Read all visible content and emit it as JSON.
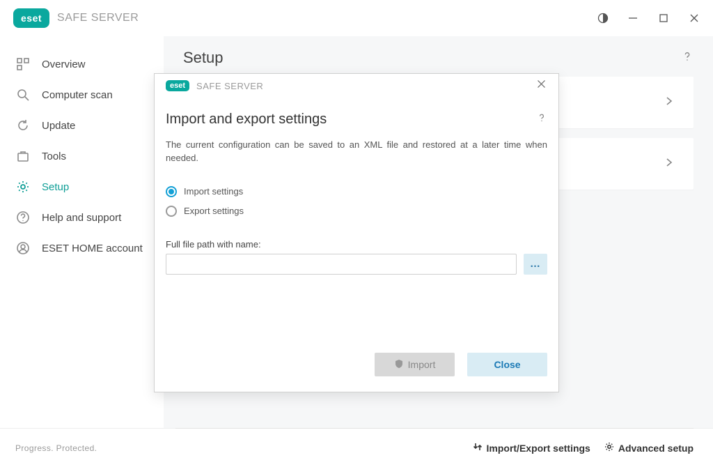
{
  "titlebar": {
    "logo_text": "eset",
    "product_name": "SAFE SERVER"
  },
  "sidebar": {
    "items": [
      {
        "label": "Overview"
      },
      {
        "label": "Computer scan"
      },
      {
        "label": "Update"
      },
      {
        "label": "Tools"
      },
      {
        "label": "Setup"
      },
      {
        "label": "Help and support"
      },
      {
        "label": "ESET HOME account"
      }
    ]
  },
  "content": {
    "title": "Setup"
  },
  "modal": {
    "logo_text": "eset",
    "product_name": "SAFE SERVER",
    "heading": "Import and export settings",
    "description": "The current configuration can be saved to an XML file and restored at a later time when needed.",
    "options": {
      "import": "Import settings",
      "export": "Export settings",
      "selected": "import"
    },
    "file_label": "Full file path with name:",
    "file_value": "",
    "browse_label": "…",
    "import_btn": "Import",
    "close_btn": "Close"
  },
  "footer": {
    "tagline": "Progress. Protected.",
    "import_export": "Import/Export settings",
    "advanced": "Advanced setup"
  }
}
